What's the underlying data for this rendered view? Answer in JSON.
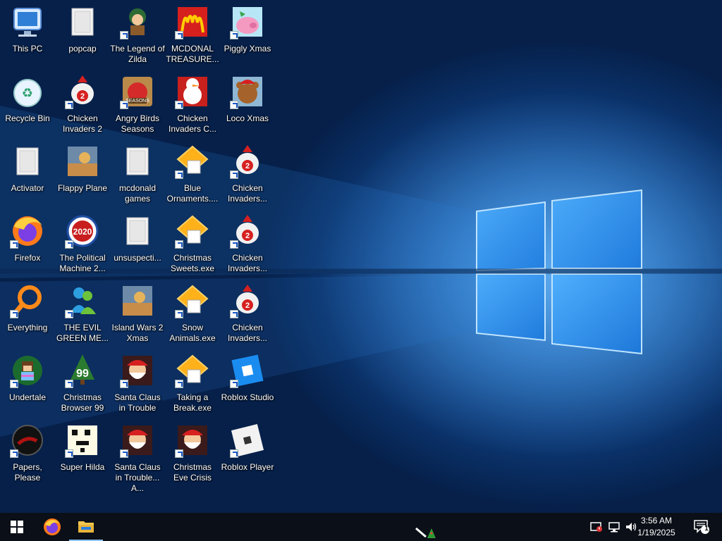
{
  "desktop": {
    "icons": [
      {
        "label": "This PC",
        "icon": "computer-icon"
      },
      {
        "label": "Recycle Bin",
        "icon": "recycle-bin-icon"
      },
      {
        "label": "Activator",
        "icon": "folder-icon"
      },
      {
        "label": "Firefox",
        "icon": "firefox-icon"
      },
      {
        "label": "Everything",
        "icon": "everything-search-icon"
      },
      {
        "label": "Undertale",
        "icon": "undertale-icon"
      },
      {
        "label": "Papers, Please",
        "icon": "papers-please-icon"
      },
      {
        "label": "popcap",
        "icon": "folder-icon"
      },
      {
        "label": "Chicken Invaders 2",
        "icon": "chicken-invaders-icon"
      },
      {
        "label": "Flappy Plane",
        "icon": "game-icon"
      },
      {
        "label": "The Political Machine 2...",
        "icon": "political-machine-icon"
      },
      {
        "label": "THE EVIL GREEN ME...",
        "icon": "messenger-icon"
      },
      {
        "label": "Christmas Browser 99",
        "icon": "christmas-tree-icon"
      },
      {
        "label": "Super Hilda",
        "icon": "pixel-game-icon"
      },
      {
        "label": "The Legend of Zilda",
        "icon": "legend-of-zilda-icon"
      },
      {
        "label": "Angry Birds Seasons",
        "icon": "angry-birds-icon"
      },
      {
        "label": "mcdonald games",
        "icon": "folder-icon"
      },
      {
        "label": "unsuspecti...",
        "icon": "folder-icon"
      },
      {
        "label": "Island Wars 2 Xmas",
        "icon": "game-icon"
      },
      {
        "label": "Santa Claus in Trouble",
        "icon": "santa-icon"
      },
      {
        "label": "Santa Claus in Trouble... A...",
        "icon": "santa-icon"
      },
      {
        "label": "MCDONAL TREASURE...",
        "icon": "mcdonalds-icon"
      },
      {
        "label": "Chicken Invaders C...",
        "icon": "snowman-icon"
      },
      {
        "label": "Blue Ornaments....",
        "icon": "puzzle-icon"
      },
      {
        "label": "Christmas Sweets.exe",
        "icon": "puzzle-icon"
      },
      {
        "label": "Snow Animals.exe",
        "icon": "puzzle-icon"
      },
      {
        "label": "Taking a Break.exe",
        "icon": "puzzle-icon"
      },
      {
        "label": "Christmas Eve Crisis",
        "icon": "santa-icon"
      },
      {
        "label": "Piggly Xmas",
        "icon": "pig-icon"
      },
      {
        "label": "Loco Xmas",
        "icon": "bear-icon"
      },
      {
        "label": "Chicken Invaders...",
        "icon": "chicken-invaders-icon"
      },
      {
        "label": "Chicken Invaders...",
        "icon": "chicken-invaders-icon"
      },
      {
        "label": "Chicken Invaders...",
        "icon": "chicken-invaders-icon"
      },
      {
        "label": "Roblox Studio",
        "icon": "roblox-studio-icon"
      },
      {
        "label": "Roblox Player",
        "icon": "roblox-icon"
      }
    ]
  },
  "taskbar": {
    "start": "windows-start-icon",
    "pinned": [
      "firefox-icon",
      "file-explorer-icon"
    ],
    "tray_icons": [
      "defender-warning-icon",
      "network-icon",
      "volume-icon"
    ],
    "time": "3:56 AM",
    "date": "1/19/2025",
    "notification_count": "1"
  }
}
